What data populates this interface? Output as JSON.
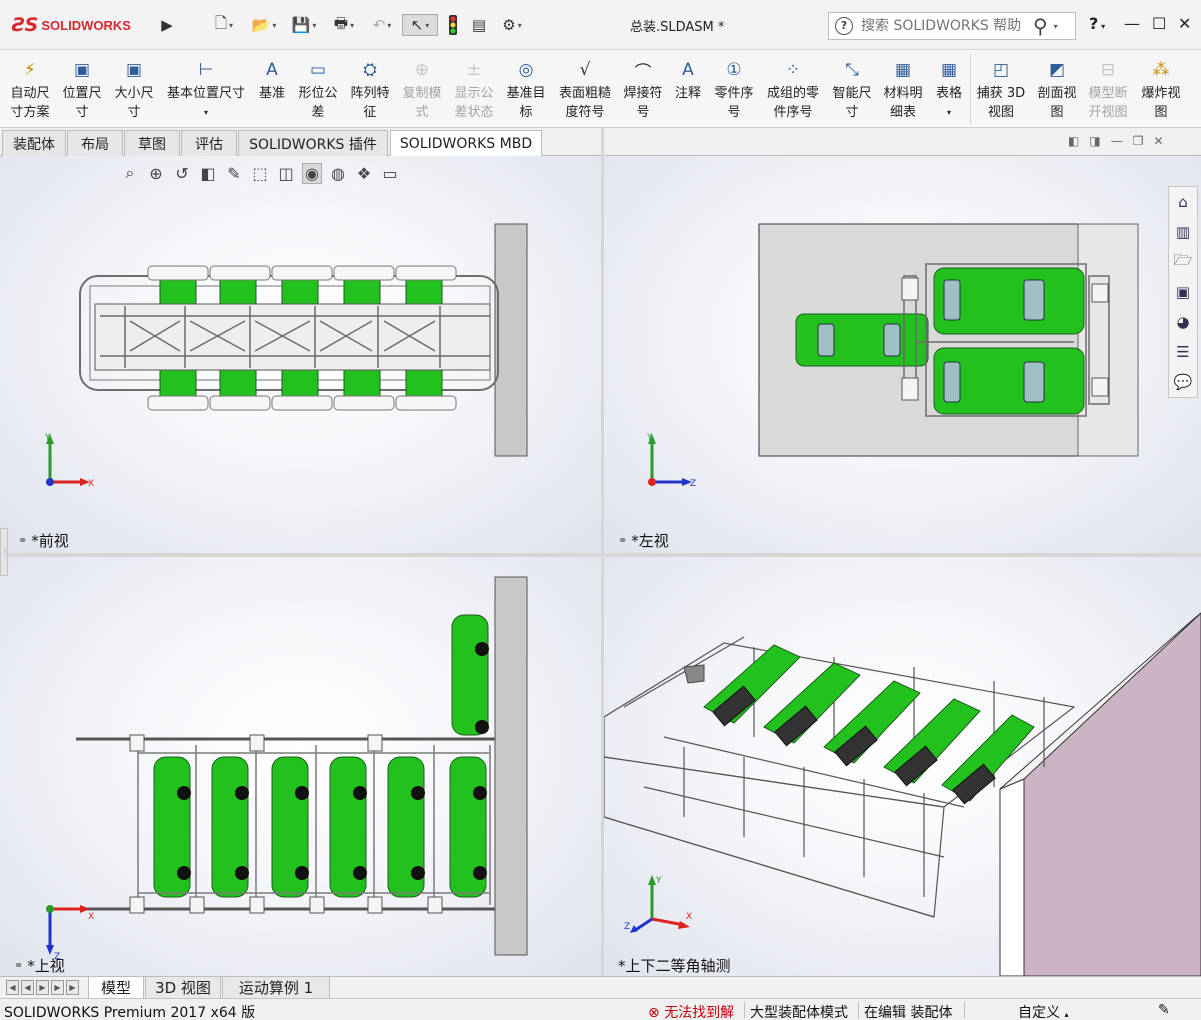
{
  "app": {
    "brand": "SOLIDWORKS",
    "doc_title": "总装.SLDASM *"
  },
  "search": {
    "placeholder": "搜索 SOLIDWORKS 帮助",
    "help_symbol": "?"
  },
  "window": {
    "help": "?",
    "minimize": "—",
    "maximize": "☐",
    "close": "✕"
  },
  "ribbon": {
    "items": [
      {
        "l1": "自动尺",
        "l2": "寸方案",
        "icon": "auto-dimension-scheme-icon"
      },
      {
        "l1": "位置尺",
        "l2": "寸",
        "icon": "location-dimension-icon"
      },
      {
        "l1": "大小尺",
        "l2": "寸",
        "icon": "size-dimension-icon"
      },
      {
        "l1": "基本位置尺寸",
        "l2": "",
        "icon": "basic-location-dimension-icon"
      },
      {
        "l1": "基准",
        "l2": "",
        "icon": "datum-icon"
      },
      {
        "l1": "形位公",
        "l2": "差",
        "icon": "geometric-tolerance-icon"
      },
      {
        "l1": "阵列特",
        "l2": "征",
        "icon": "pattern-feature-icon"
      },
      {
        "l1": "复制模",
        "l2": "式",
        "icon": "copy-scheme-icon"
      },
      {
        "l1": "显示公",
        "l2": "差状态",
        "icon": "show-tolerance-status-icon"
      },
      {
        "l1": "基准目",
        "l2": "标",
        "icon": "datum-target-icon"
      },
      {
        "l1": "表面粗糙",
        "l2": "度符号",
        "icon": "surface-finish-icon"
      },
      {
        "l1": "焊接符",
        "l2": "号",
        "icon": "weld-symbol-icon"
      },
      {
        "l1": "注释",
        "l2": "",
        "icon": "note-icon"
      },
      {
        "l1": "零件序",
        "l2": "号",
        "icon": "balloon-icon"
      },
      {
        "l1": "成组的零",
        "l2": "件序号",
        "icon": "stacked-balloon-icon"
      },
      {
        "l1": "智能尺",
        "l2": "寸",
        "icon": "smart-dimension-icon"
      },
      {
        "l1": "材料明",
        "l2": "细表",
        "icon": "bom-icon"
      },
      {
        "l1": "表格",
        "l2": "",
        "icon": "table-icon"
      },
      {
        "l1": "捕获 3D",
        "l2": "视图",
        "icon": "capture-3d-view-icon"
      },
      {
        "l1": "剖面视",
        "l2": "图",
        "icon": "section-view-icon"
      },
      {
        "l1": "模型断",
        "l2": "开视图",
        "icon": "model-break-view-icon"
      },
      {
        "l1": "爆炸视",
        "l2": "图",
        "icon": "explode-view-icon"
      }
    ]
  },
  "command_tabs": [
    "装配体",
    "布局",
    "草图",
    "评估",
    "SOLIDWORKS 插件",
    "SOLIDWORKS MBD"
  ],
  "viewports": {
    "front": "*前视",
    "left": "*左视",
    "top": "*上视",
    "iso": "*上下二等角轴测"
  },
  "axes": {
    "x": "X",
    "y": "Y",
    "z": "Z"
  },
  "bottom_tabs": [
    "模型",
    "3D 视图",
    "运动算例 1"
  ],
  "status": {
    "product": "SOLIDWORKS Premium 2017 x64 版",
    "error": "无法找到解",
    "mode": "大型装配体模式",
    "editing": "在编辑 装配体",
    "custom": "自定义"
  },
  "colors": {
    "car_green": "#22c11e",
    "frame_gray": "#6d6d6d",
    "wall": "#c8c8c8",
    "wall_iso": "#cbb4c4",
    "error_red": "#c0000a"
  }
}
